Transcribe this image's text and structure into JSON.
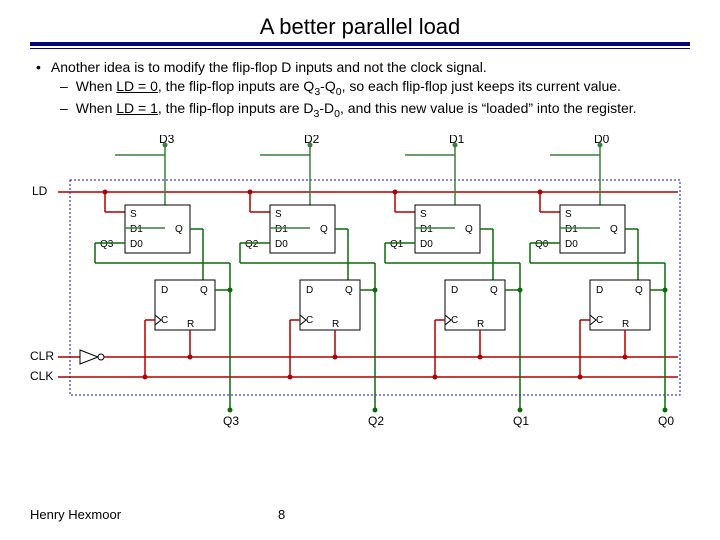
{
  "title": "A better parallel load",
  "bullets": {
    "main": "Another idea is to modify the flip-flop D inputs and not the clock signal.",
    "sub1_pre": "When ",
    "sub1_cond": "LD = 0",
    "sub1_post": ", the flip-flop inputs are Q",
    "sub1_hi": "3",
    "sub1_mid": "-Q",
    "sub1_lo": "0",
    "sub1_tail": ", so each flip-flop just keeps its current value.",
    "sub2_pre": "When ",
    "sub2_cond": "LD = 1",
    "sub2_post": ", the flip-flop inputs are D",
    "sub2_hi": "3",
    "sub2_mid": "-D",
    "sub2_lo": "0",
    "sub2_tail": ", and this new value is “loaded” into the register."
  },
  "signals": {
    "ld": "LD",
    "clr": "CLR",
    "clk": "CLK"
  },
  "inputs": [
    "D3",
    "D2",
    "D1",
    "D0"
  ],
  "outputs": [
    "Q3",
    "Q2",
    "Q1",
    "Q0"
  ],
  "mux": {
    "s": "S",
    "d1": "D1",
    "d0": "D0",
    "q": "Q"
  },
  "ff": {
    "d": "D",
    "q": "Q",
    "c": "C",
    "r": "R"
  },
  "footer": {
    "author": "Henry Hexmoor",
    "page": "8"
  },
  "chart_data": {
    "type": "table",
    "description": "4-bit register with parallel-load enable. Each bit has a 2:1 mux (S=LD; D1=parallel Di; D0=current Qi) feeding a D flip-flop clocked by CLK with asynchronous CLR.",
    "bits": [
      {
        "index": 3,
        "parallel_in": "D3",
        "hold_in": "Q3",
        "output": "Q3"
      },
      {
        "index": 2,
        "parallel_in": "D2",
        "hold_in": "Q2",
        "output": "Q2"
      },
      {
        "index": 1,
        "parallel_in": "D1",
        "hold_in": "Q1",
        "output": "Q1"
      },
      {
        "index": 0,
        "parallel_in": "D0",
        "hold_in": "Q0",
        "output": "Q0"
      }
    ],
    "control": {
      "load": "LD",
      "clock": "CLK",
      "clear": "CLR"
    }
  }
}
